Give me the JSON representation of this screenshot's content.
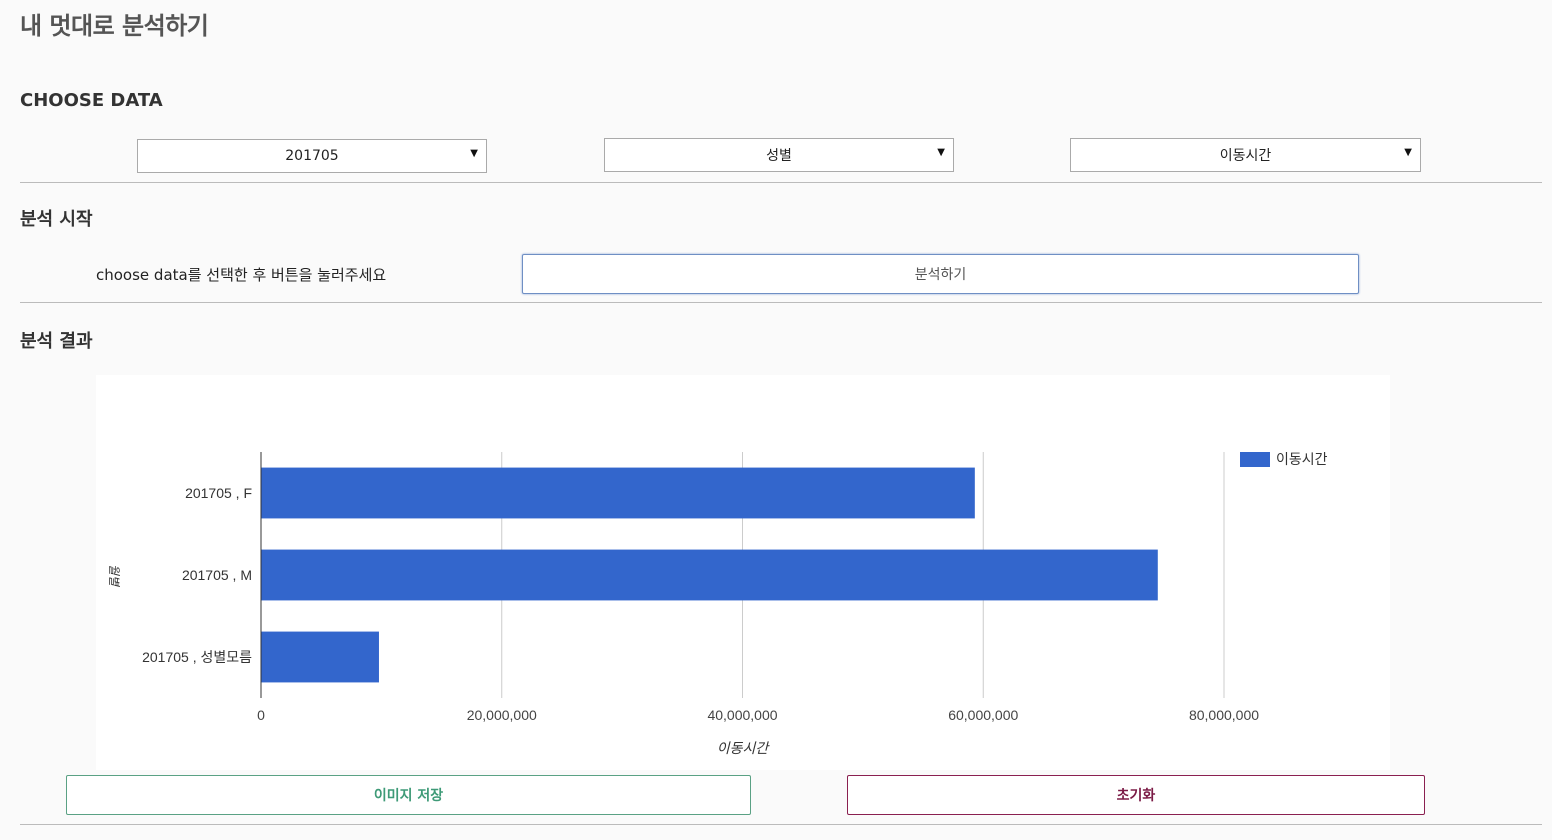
{
  "page": {
    "title": "내 멋대로 분석하기"
  },
  "choose_data": {
    "title": "CHOOSE DATA",
    "selects": [
      {
        "value": "201705"
      },
      {
        "value": "성별"
      },
      {
        "value": "이동시간"
      }
    ]
  },
  "start": {
    "title": "분석 시작",
    "hint": "choose data를 선택한 후 버튼을 눌러주세요",
    "button_label": "분석하기"
  },
  "result": {
    "title": "분석 결과",
    "save_label": "이미지 저장",
    "reset_label": "초기화"
  },
  "chart_data": {
    "type": "bar",
    "orientation": "horizontal",
    "categories": [
      "201705 , F",
      "201705 , M",
      "201705 , 성별모름"
    ],
    "series": [
      {
        "name": "이동시간",
        "values": [
          59300000,
          74500000,
          9800000
        ]
      }
    ],
    "xlabel": "이동시간",
    "ylabel": "월별",
    "xlim": [
      0,
      80000000
    ],
    "xticks": [
      "0",
      "20,000,000",
      "40,000,000",
      "60,000,000",
      "80,000,000"
    ],
    "grid": true,
    "legend": "right",
    "color": "#3366cc"
  }
}
